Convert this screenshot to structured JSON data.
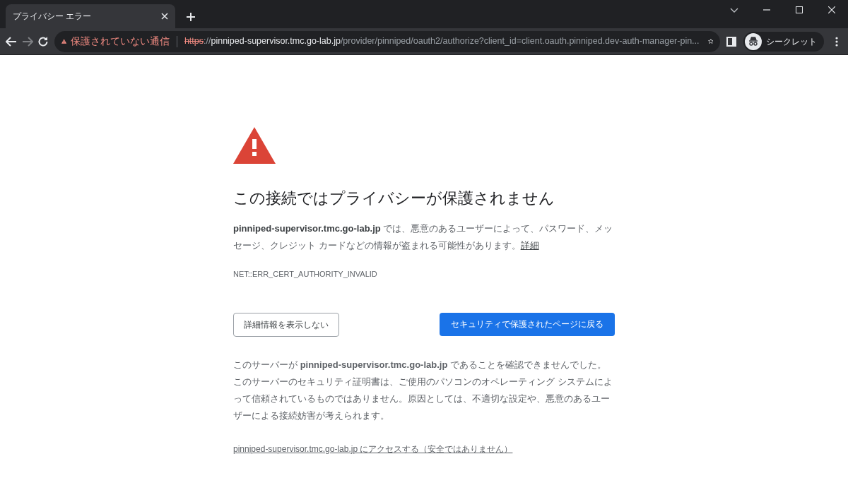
{
  "tabs": [
    {
      "title": "プライバシー エラー",
      "selected": true
    }
  ],
  "toolbar": {
    "forward_disabled": true,
    "security_label": "保護されていない通信",
    "url_parts": [
      {
        "kind": "scheme",
        "text": "https"
      },
      {
        "kind": "separator",
        "text": "://"
      },
      {
        "kind": "host",
        "text": "pinniped-supervisor.tmc.go-lab.jp"
      },
      {
        "kind": "path",
        "text": "/provider/pinniped/oauth2/authorize?client_id=client.oauth.pinniped.dev-auth-manager-pin..."
      }
    ],
    "profile_label": "シークレット"
  },
  "content": {
    "heading": "この接続ではプライバシーが保護されません",
    "intro": "**pinniped-supervisor.tmc.go-lab.jp** では、悪意のあるユーザーによって、パスワード、メッセージ、クレジット カードなどの情報が盗まれる可能性があります。",
    "details_link": "詳細",
    "error_code": "NET::ERR_CERT_AUTHORITY_INVALID",
    "buttons": [
      {
        "kind": "secondary",
        "label": "詳細情報を表示しない"
      },
      {
        "kind": "primary",
        "label": "セキュリティで保護されたページに戻る"
      }
    ],
    "explanation": "このサーバーが **pinniped-supervisor.tmc.go-lab.jp** であることを確認できませんでした。このサーバーのセキュリティ証明書は、ご使用のパソコンのオペレーティング システムによって信頼されているものではありません。原因としては、不適切な設定や、悪意のあるユーザーによる接続妨害が考えられます。",
    "proceed_link": "pinniped-supervisor.tmc.go-lab.jp にアクセスする（安全ではありません）"
  }
}
